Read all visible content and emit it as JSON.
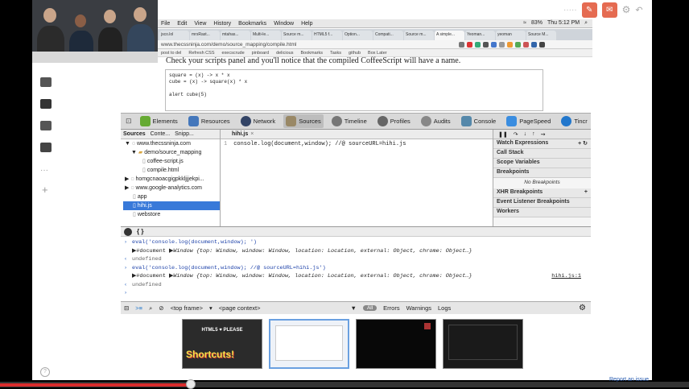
{
  "mac_menubar": {
    "items": [
      "File",
      "Edit",
      "View",
      "History",
      "Bookmarks",
      "Window",
      "Help"
    ],
    "battery": "83%",
    "clock": "Thu 5:12 PM"
  },
  "browser_tabs": [
    "jsco.lol",
    "mrsRast...",
    "mtahas...",
    "Multi-le...",
    "Source m...",
    "HTML5 f...",
    "Option...",
    "Compati...",
    "Source m...",
    "A simple...",
    "Yeoman...",
    "yeoman",
    "Source M..."
  ],
  "url": "www.thecssninja.com/demo/source_mapping/compile.html",
  "bookmarks": [
    "post to del",
    "Refresh CSS",
    "execscrude",
    "pinboard",
    "delicious",
    "Bookmarks",
    "Tasks",
    "github",
    "Box Later"
  ],
  "page": {
    "heading": "Check your scripts panel and you'll notice that the compiled CoffeeScript will have a name.",
    "code_lines": [
      "square = (x) -> x * x",
      "cube   = (x) -> square(x) * x",
      "",
      "alert cube(5)"
    ]
  },
  "devtools": {
    "toolbar": [
      "Elements",
      "Resources",
      "Network",
      "Sources",
      "Timeline",
      "Profiles",
      "Audits",
      "Console",
      "PageSpeed",
      "Tincr"
    ],
    "active_panel": "Sources",
    "left_tabs": [
      "Sources",
      "Conte...",
      "Snipp..."
    ],
    "tree": [
      {
        "label": "www.thecssninja.com",
        "level": 0
      },
      {
        "label": "demo/source_mapping",
        "level": 1
      },
      {
        "label": "coffee-script.js",
        "level": 2
      },
      {
        "label": "compile.html",
        "level": 2
      },
      {
        "label": "homgcnaoacgigpkkljjjekpi...",
        "level": 0
      },
      {
        "label": "www.google-analytics.com",
        "level": 0
      },
      {
        "label": "app",
        "level": 0
      },
      {
        "label": "hihi.js",
        "level": 0,
        "selected": true
      },
      {
        "label": "webstore",
        "level": 0
      }
    ],
    "editor_tab": "hihi.js",
    "editor_line_number": "1",
    "editor_code": "console.log(document,window); //@ sourceURL=hihi.js",
    "right_sections": [
      "Watch Expressions",
      "Call Stack",
      "Scope Variables",
      "Breakpoints",
      "XHR Breakpoints",
      "Event Listener Breakpoints",
      "Workers"
    ],
    "no_breakpoints": "No Breakpoints",
    "console": {
      "line1": "eval('console.log(document,window); ')",
      "line2a": "#document",
      "line2b": "Window {top: Window, window: Window, location: Location, external: Object, chrome: Object…}",
      "line3": "undefined",
      "line4": "eval('console.log(document,window); //@ sourceURL=hihi.js')",
      "line5a": "#document",
      "line5b": "Window {top: Window, window: Window, location: Location, external: Object, chrome: Object…}",
      "line5link": "hihi.js:1",
      "line6": "undefined"
    },
    "console_bar": {
      "frame": "<top frame>",
      "context": "<page context>",
      "filters": [
        "All",
        "Errors",
        "Warnings",
        "Logs"
      ]
    }
  },
  "thumbnails": [
    {
      "title": "HTML5 ♥ PLEASE",
      "caption": "Shortcuts!"
    },
    {
      "title": "",
      "caption": ""
    },
    {
      "title": "",
      "caption": ""
    },
    {
      "title": "",
      "caption": ""
    }
  ],
  "report_link": "Report an issue",
  "colors": {
    "accent": "#e56b51",
    "progress": "#d92c2c",
    "selection": "#3879d9"
  }
}
